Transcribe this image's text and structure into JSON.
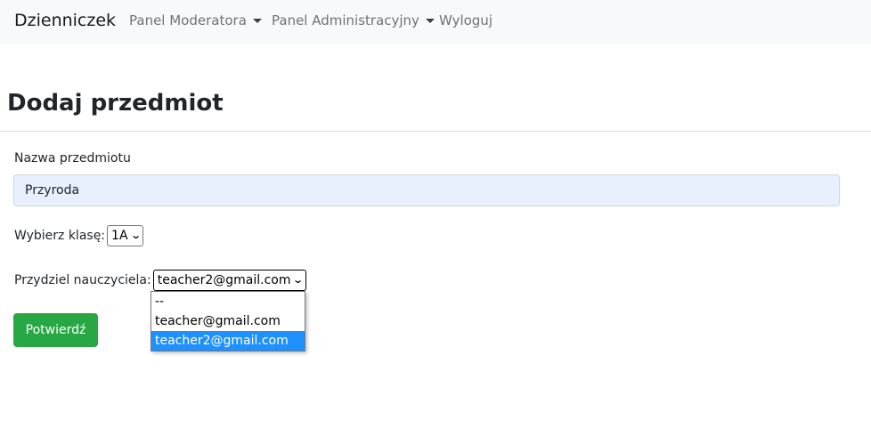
{
  "navbar": {
    "brand": "Dzienniczek",
    "items": [
      {
        "label": "Panel Moderatora",
        "dropdown": true
      },
      {
        "label": "Panel Administracyjny",
        "dropdown": true
      },
      {
        "label": "Wyloguj",
        "dropdown": false
      }
    ]
  },
  "page": {
    "title": "Dodaj przedmiot"
  },
  "form": {
    "subject_label": "Nazwa przedmiotu",
    "subject_value": "Przyroda",
    "class_label": "Wybierz klasę:",
    "class_selected": "1A",
    "teacher_label": "Przydziel nauczyciela:",
    "teacher_selected": "teacher2@gmail.com",
    "teacher_options": [
      "--",
      "teacher@gmail.com",
      "teacher2@gmail.com"
    ],
    "submit_label": "Potwierdź"
  },
  "colors": {
    "navbar_bg": "#f8f9fa",
    "input_autofill_bg": "#e8f0fe",
    "submit_bg": "#28a745",
    "option_highlight": "#1e90ff"
  },
  "icons": {
    "nav_dropdown": "caret-down-icon",
    "select_arrow": "chevron-down-icon"
  }
}
